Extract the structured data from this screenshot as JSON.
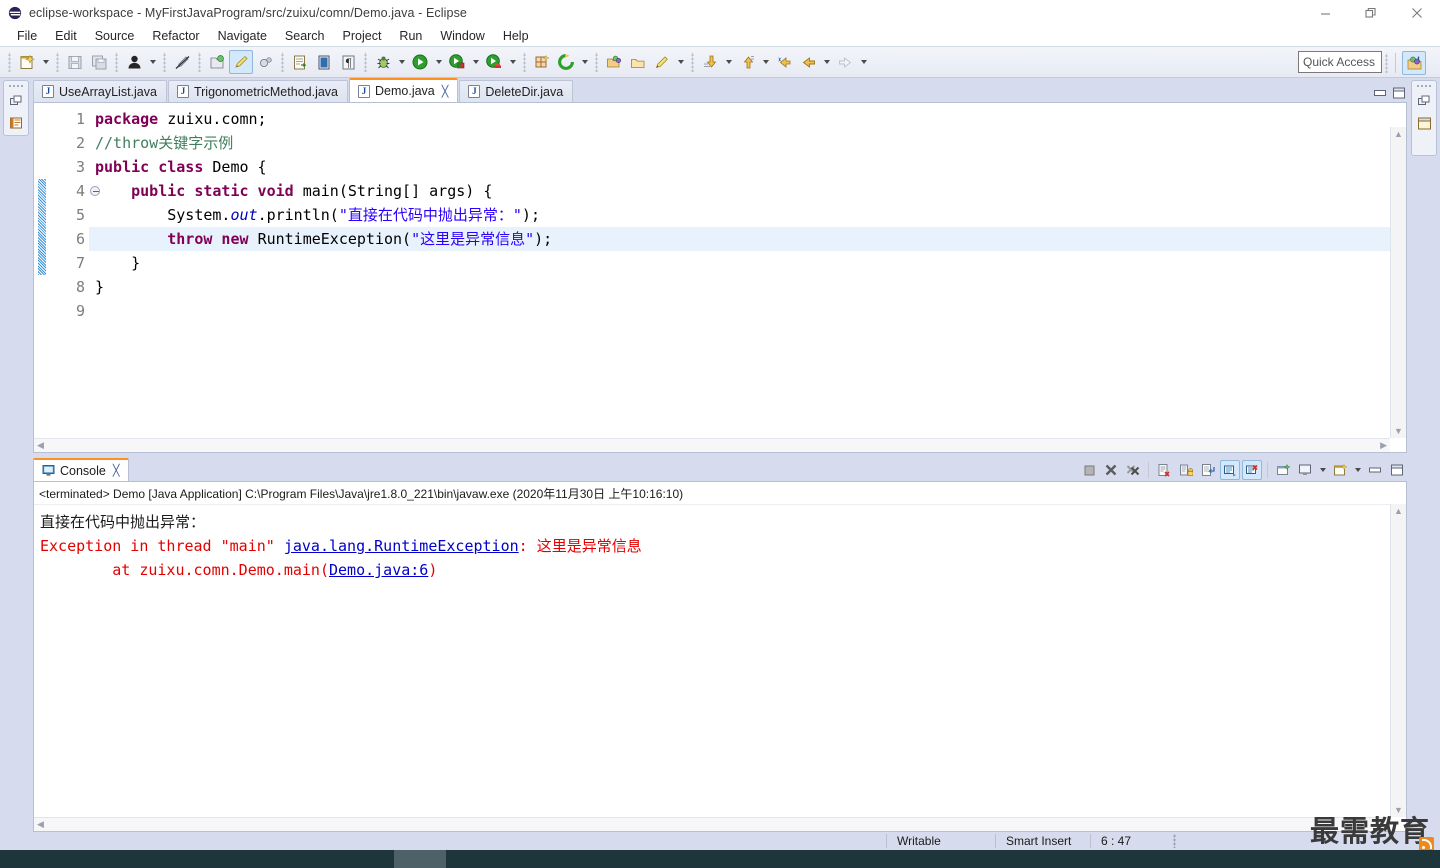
{
  "window": {
    "title": "eclipse-workspace - MyFirstJavaProgram/src/zuixu/comn/Demo.java - Eclipse",
    "minimize_label": "Minimize",
    "restore_label": "Restore",
    "close_label": "Close"
  },
  "menu": {
    "items": [
      "File",
      "Edit",
      "Source",
      "Refactor",
      "Navigate",
      "Search",
      "Project",
      "Run",
      "Window",
      "Help"
    ]
  },
  "toolbar": {
    "quick_access_placeholder": "Quick Access",
    "buttons": [
      {
        "name": "new-wizard",
        "icon": "new-file-icon"
      },
      {
        "name": "save",
        "icon": "save-icon"
      },
      {
        "name": "save-all",
        "icon": "save-all-icon"
      },
      {
        "name": "skip-breakpoints",
        "icon": "person-icon"
      },
      {
        "name": "toggle-mark-occurrences",
        "icon": "pencil-strike-icon"
      },
      {
        "name": "new-java-package",
        "icon": "package-icon"
      },
      {
        "name": "new-java-class",
        "icon": "class-icon"
      },
      {
        "name": "new-java-interface",
        "icon": "interface-icon"
      },
      {
        "name": "open-type",
        "icon": "open-type-icon"
      },
      {
        "name": "open-task",
        "icon": "task-icon"
      },
      {
        "name": "pilcrow",
        "icon": "pilcrow-icon"
      },
      {
        "name": "debug",
        "icon": "bug-icon"
      },
      {
        "name": "run",
        "icon": "run-icon"
      },
      {
        "name": "run-external-tools",
        "icon": "external-tools-icon"
      },
      {
        "name": "coverage",
        "icon": "coverage-icon"
      },
      {
        "name": "new-window",
        "icon": "grid-icon"
      },
      {
        "name": "refresh",
        "icon": "refresh-icon"
      },
      {
        "name": "open-resource",
        "icon": "folder-open-icon"
      },
      {
        "name": "open-folder",
        "icon": "folder-icon"
      },
      {
        "name": "edit-annotation",
        "icon": "pen-icon"
      },
      {
        "name": "next-annotation",
        "icon": "down-arrow-icon"
      },
      {
        "name": "previous-annotation",
        "icon": "up-arrow-icon"
      },
      {
        "name": "back-to-marker",
        "icon": "back-marker-icon"
      },
      {
        "name": "back",
        "icon": "back-arrow-icon"
      },
      {
        "name": "forward",
        "icon": "forward-arrow-icon"
      }
    ],
    "perspective_open_label": "Open Perspective",
    "perspective_java_label": "Java"
  },
  "editor": {
    "tabs": [
      {
        "label": "UseArrayList.java",
        "active": false,
        "closable": false
      },
      {
        "label": "TrigonometricMethod.java",
        "active": false,
        "closable": false
      },
      {
        "label": "Demo.java",
        "active": true,
        "closable": true
      },
      {
        "label": "DeleteDir.java",
        "active": false,
        "closable": false
      }
    ],
    "file_icon_letter": "J",
    "close_glyph": "╳",
    "minimize_label": "Minimize",
    "maximize_label": "Maximize",
    "lines": [
      {
        "n": "1",
        "fold": false,
        "changed": false,
        "highlight": false,
        "tokens": [
          {
            "t": "package ",
            "c": "kw"
          },
          {
            "t": "zuixu.comn;",
            "c": "pl"
          }
        ]
      },
      {
        "n": "2",
        "fold": false,
        "changed": false,
        "highlight": false,
        "tokens": [
          {
            "t": "//throw关键字示例",
            "c": "cm"
          }
        ]
      },
      {
        "n": "3",
        "fold": false,
        "changed": false,
        "highlight": false,
        "tokens": [
          {
            "t": "public class ",
            "c": "kw"
          },
          {
            "t": "Demo {",
            "c": "pl"
          }
        ]
      },
      {
        "n": "4",
        "fold": true,
        "changed": true,
        "highlight": false,
        "tokens": [
          {
            "t": "    ",
            "c": "pl"
          },
          {
            "t": "public static void ",
            "c": "kw"
          },
          {
            "t": "main(String[] args) {",
            "c": "pl"
          }
        ]
      },
      {
        "n": "5",
        "fold": false,
        "changed": true,
        "highlight": false,
        "tokens": [
          {
            "t": "        System.",
            "c": "pl"
          },
          {
            "t": "out",
            "c": "fld"
          },
          {
            "t": ".println(",
            "c": "pl"
          },
          {
            "t": "\"直接在代码中抛出异常：\"",
            "c": "st"
          },
          {
            "t": ");",
            "c": "pl"
          }
        ]
      },
      {
        "n": "6",
        "fold": false,
        "changed": true,
        "highlight": true,
        "tokens": [
          {
            "t": "        ",
            "c": "pl"
          },
          {
            "t": "throw new ",
            "c": "kw"
          },
          {
            "t": "RuntimeException(",
            "c": "pl"
          },
          {
            "t": "\"这里是异常信息\"",
            "c": "st"
          },
          {
            "t": ");",
            "c": "pl"
          }
        ]
      },
      {
        "n": "7",
        "fold": false,
        "changed": true,
        "highlight": false,
        "tokens": [
          {
            "t": "    }",
            "c": "pl"
          }
        ]
      },
      {
        "n": "8",
        "fold": false,
        "changed": false,
        "highlight": false,
        "tokens": [
          {
            "t": "}",
            "c": "pl"
          }
        ]
      },
      {
        "n": "9",
        "fold": false,
        "changed": false,
        "highlight": false,
        "tokens": []
      }
    ]
  },
  "console": {
    "tab_label": "Console",
    "tab_icon": "console-monitor-icon",
    "close_glyph": "╳",
    "terminated_line": "<terminated> Demo [Java Application] C:\\Program Files\\Java\\jre1.8.0_221\\bin\\javaw.exe (2020年11月30日 上午10:16:10)",
    "output": [
      {
        "segments": [
          {
            "t": "直接在代码中抛出异常：",
            "c": "plain",
            "cjk": true
          }
        ]
      },
      {
        "segments": [
          {
            "t": "Exception in thread \"main\" ",
            "c": "err"
          },
          {
            "t": "java.lang.RuntimeException",
            "c": "link"
          },
          {
            "t": ": ",
            "c": "err"
          },
          {
            "t": "这里是异常信息",
            "c": "err",
            "cjk": true
          }
        ]
      },
      {
        "segments": [
          {
            "t": "\tat zuixu.comn.Demo.main(",
            "c": "err"
          },
          {
            "t": "Demo.java:6",
            "c": "link"
          },
          {
            "t": ")",
            "c": "err"
          }
        ]
      }
    ],
    "buttons": [
      {
        "name": "terminate",
        "icon": "stop-square-icon"
      },
      {
        "name": "remove-launch",
        "icon": "remove-x-icon"
      },
      {
        "name": "remove-all-terminated",
        "icon": "remove-all-xx-icon"
      },
      {
        "name": "clear-console",
        "icon": "clear-console-icon"
      },
      {
        "name": "scroll-lock",
        "icon": "lock-icon"
      },
      {
        "name": "word-wrap",
        "icon": "word-wrap-icon"
      },
      {
        "name": "show-console-when-stdout",
        "icon": "stdout-console-icon"
      },
      {
        "name": "show-console-when-stderr",
        "icon": "stderr-console-icon"
      },
      {
        "name": "pin-console",
        "icon": "pin-icon"
      },
      {
        "name": "display-selected-console",
        "icon": "display-console-icon"
      },
      {
        "name": "open-console",
        "icon": "open-console-icon"
      },
      {
        "name": "minimize",
        "icon": "minimize-icon"
      },
      {
        "name": "maximize",
        "icon": "maximize-icon"
      }
    ]
  },
  "statusbar": {
    "writable": "Writable",
    "insert_mode": "Smart Insert",
    "position": "6 : 47"
  },
  "watermark": {
    "text": "最需教育",
    "badge_icon": "rss-icon"
  },
  "colors": {
    "keyword": "#7f0055",
    "string": "#2a00ff",
    "comment": "#3f7f5f",
    "field": "#0000c0",
    "error": "#e50000",
    "link": "#0000cc",
    "tab_accent": "#ff8f1f",
    "highlight_line": "#e8f2fd"
  }
}
